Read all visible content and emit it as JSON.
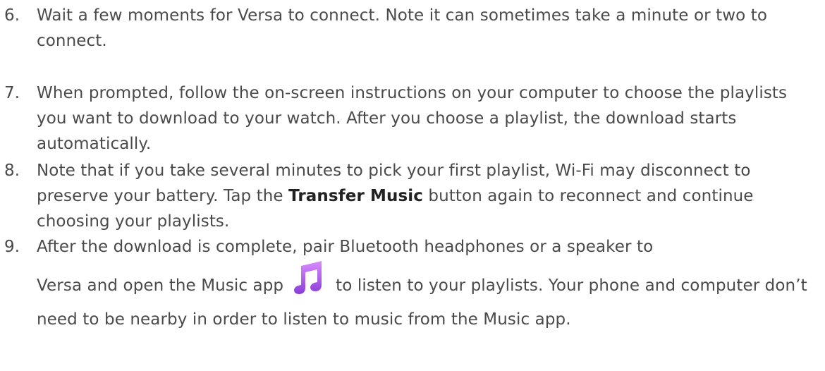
{
  "steps": [
    {
      "number": "6.",
      "text": "Wait a few moments for Versa to connect. Note it can sometimes take a minute or two to connect."
    },
    {
      "number": "7.",
      "text": "When prompted, follow the on-screen instructions on your computer to choose the playlists you want to download to your watch. After you choose a playlist, the download starts automatically."
    },
    {
      "number": "8.",
      "text_before": "Note that if you take several minutes to pick your first playlist, Wi-Fi may disconnect to preserve your battery. Tap the ",
      "bold": "Transfer Music",
      "text_after": " button again to reconnect and continue choosing your playlists."
    },
    {
      "number": "9.",
      "text_line1": "After the download is complete, pair Bluetooth headphones or a speaker to",
      "text_before_icon": "Versa and open the Music app",
      "icon": "music-note-icon",
      "text_after_icon": "to listen to your playlists. Your phone and computer don’t need to be nearby in order to listen to music from the Music app."
    }
  ],
  "colors": {
    "text": "#4a4a4a",
    "icon_gradient_top": "#d98cff",
    "icon_gradient_bottom": "#8a3dd6"
  }
}
